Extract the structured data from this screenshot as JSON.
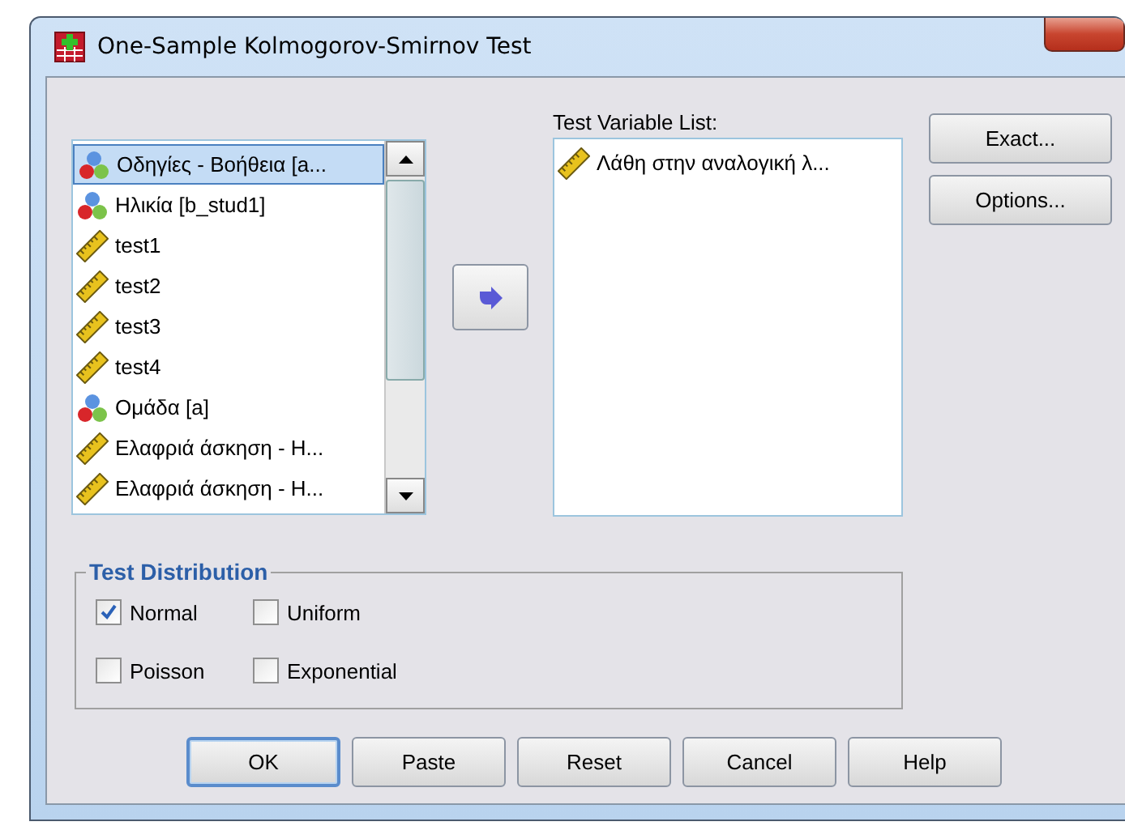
{
  "window": {
    "title": "One-Sample Kolmogorov-Smirnov Test"
  },
  "source_list": {
    "items": [
      {
        "label": "Οδηγίες - Βοήθεια [a...",
        "kind": "nominal",
        "selected": true
      },
      {
        "label": "Ηλικία [b_stud1]",
        "kind": "nominal",
        "selected": false
      },
      {
        "label": "test1",
        "kind": "scale",
        "selected": false
      },
      {
        "label": "test2",
        "kind": "scale",
        "selected": false
      },
      {
        "label": "test3",
        "kind": "scale",
        "selected": false
      },
      {
        "label": "test4",
        "kind": "scale",
        "selected": false
      },
      {
        "label": "Ομάδα [a]",
        "kind": "nominal",
        "selected": false
      },
      {
        "label": "Ελαφριά άσκηση - Η...",
        "kind": "scale",
        "selected": false
      },
      {
        "label": "Ελαφριά άσκηση - Η...",
        "kind": "scale",
        "selected": false
      }
    ]
  },
  "test_variable_list": {
    "label": "Test Variable List:",
    "items": [
      {
        "label": "Λάθη στην αναλογική λ...",
        "kind": "scale",
        "selected": false
      }
    ]
  },
  "side_buttons": [
    "Exact...",
    "Options..."
  ],
  "test_distribution": {
    "title": "Test Distribution",
    "options": [
      {
        "label": "Normal",
        "checked": true
      },
      {
        "label": "Uniform",
        "checked": false
      },
      {
        "label": "Poisson",
        "checked": false
      },
      {
        "label": "Exponential",
        "checked": false
      }
    ]
  },
  "buttons": [
    {
      "label": "OK",
      "default": true
    },
    {
      "label": "Paste",
      "default": false
    },
    {
      "label": "Reset",
      "default": false
    },
    {
      "label": "Cancel",
      "default": false
    },
    {
      "label": "Help",
      "default": false
    }
  ]
}
